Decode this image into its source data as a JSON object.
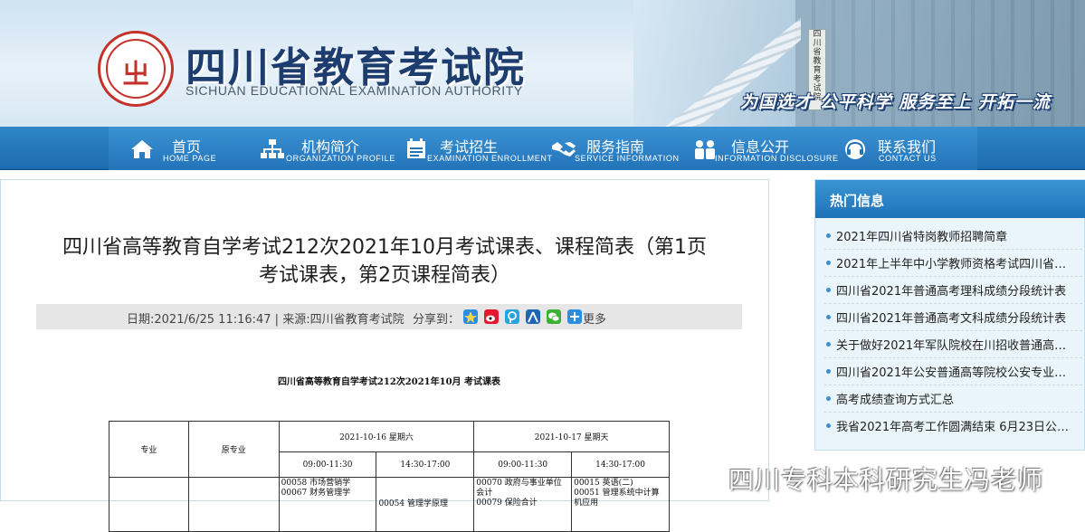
{
  "header": {
    "site_name_cn": "四川省教育考试院",
    "site_name_en": "SICHUAN EDUCATIONAL EXAMINATION AUTHORITY",
    "slogan": "为国选才 公平科学 服务至上 开拓一流",
    "logo_text": "四川省教育考试院"
  },
  "nav": {
    "items": [
      {
        "cn": "首页",
        "en": "HOME PAGE",
        "icon": "home-icon"
      },
      {
        "cn": "机构简介",
        "en": "ORGANIZATION PROFILE",
        "icon": "org-chart-icon"
      },
      {
        "cn": "考试招生",
        "en": "EXAMINATION ENROLLMENT",
        "icon": "calendar-icon"
      },
      {
        "cn": "服务指南",
        "en": "SERVICE INFORMATION",
        "icon": "handshake-icon"
      },
      {
        "cn": "信息公开",
        "en": "INFORMATION DISCLOSURE",
        "icon": "people-icon"
      },
      {
        "cn": "联系我们",
        "en": "CONTACT US",
        "icon": "headset-icon"
      }
    ]
  },
  "article": {
    "title_line1": "四川省高等教育自学考试212次2021年10月考试课表、课程简表（第1页",
    "title_line2": "考试课表，第2页课程简表）",
    "meta": "日期:2021/6/25 11:16:47 | 来源:四川省教育考试院",
    "share_label": "分享到：",
    "share_more": "更多",
    "share_icons": [
      "qzone-icon",
      "weibo-icon",
      "tencent-weibo-icon",
      "renren-icon",
      "wechat-icon",
      "plus-icon"
    ]
  },
  "schedule": {
    "title": "四川省高等教育自学考试212次2021年10月  考试课表",
    "col_major": "专业",
    "col_orig_major": "原专业",
    "day1": "2021-10-16  星期六",
    "day2": "2021-10-17  星期天",
    "slot_am": "09:00-11:30",
    "slot_pm": "14:30-17:00",
    "row1": {
      "d1_am": "00058 市场营销学\n00067 财务管理学",
      "d1_pm": "00054 管理学原理",
      "d2_am": "00070 政府与事业单位会计\n00079 保险合计",
      "d2_pm": "00015 英语(二)\n00051 管理系统中计算机应用"
    }
  },
  "sidebar": {
    "title": "热门信息",
    "items": [
      "2021年四川省特岗教师招聘简章",
      "2021年上半年中小学教师资格考试四川省…",
      "四川省2021年普通高考理科成绩分段统计表",
      "四川省2021年普通高考文科成绩分段统计表",
      "关于做好2021年军队院校在川招收普通高…",
      "四川省2021年公安普通高等院校公安专业…",
      "高考成绩查询方式汇总",
      "我省2021年高考工作圆满结束 6月23日公…"
    ]
  },
  "watermark": {
    "text": "四川专科本科研究生冯老师",
    "icon": "weibo-icon"
  },
  "colors": {
    "nav_blue": "#2373b8",
    "title_navy": "#1d3d6e",
    "logo_red": "#c5312b"
  }
}
